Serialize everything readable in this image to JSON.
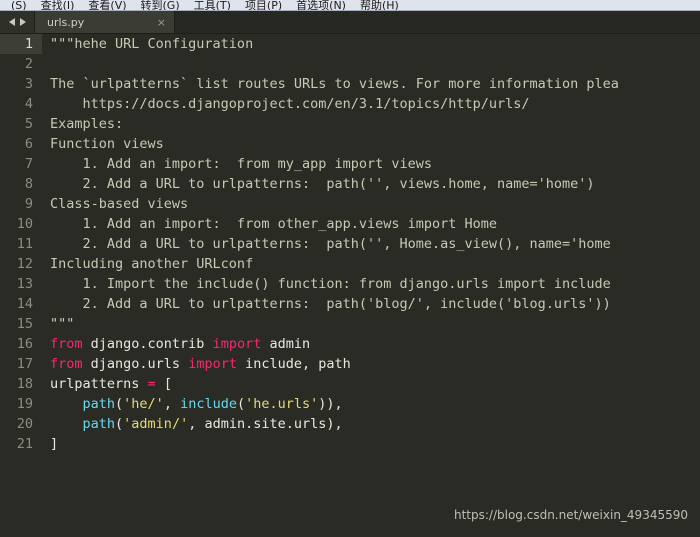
{
  "menu": {
    "items": [
      {
        "label": "(S)"
      },
      {
        "label": "查找(I)"
      },
      {
        "label": "查看(V)"
      },
      {
        "label": "转到(G)"
      },
      {
        "label": "工具(T)"
      },
      {
        "label": "项目(P)"
      },
      {
        "label": "首选项(N)"
      },
      {
        "label": "帮助(H)"
      }
    ]
  },
  "tabbar": {
    "nav_prev_icon": "arrow-left-icon",
    "nav_next_icon": "arrow-right-icon",
    "tabs": [
      {
        "label": "urls.py",
        "close_label": "×",
        "active": true
      }
    ]
  },
  "editor": {
    "active_line": 1,
    "colors": {
      "background": "#2b2b26",
      "gutter_text": "#8c8d7f",
      "active_gutter": "#3d3e35",
      "comment": "#c8c8b4",
      "keyword": "#f92672",
      "function": "#66d9ef",
      "string": "#e6db74",
      "plain": "#e8e8e0"
    },
    "lines": [
      {
        "n": "1",
        "tokens": [
          {
            "t": "doc",
            "s": "\"\"\"hehe URL Configuration"
          }
        ]
      },
      {
        "n": "2",
        "tokens": [
          {
            "t": "doc",
            "s": ""
          }
        ]
      },
      {
        "n": "3",
        "tokens": [
          {
            "t": "doc",
            "s": "The `urlpatterns` list routes URLs to views. For more information plea"
          }
        ]
      },
      {
        "n": "4",
        "tokens": [
          {
            "t": "doc",
            "s": "    https://docs.djangoproject.com/en/3.1/topics/http/urls/"
          }
        ]
      },
      {
        "n": "5",
        "tokens": [
          {
            "t": "doc",
            "s": "Examples:"
          }
        ]
      },
      {
        "n": "6",
        "tokens": [
          {
            "t": "doc",
            "s": "Function views"
          }
        ]
      },
      {
        "n": "7",
        "tokens": [
          {
            "t": "doc",
            "s": "    1. Add an import:  from my_app import views"
          }
        ]
      },
      {
        "n": "8",
        "tokens": [
          {
            "t": "doc",
            "s": "    2. Add a URL to urlpatterns:  path('', views.home, name='home')"
          }
        ]
      },
      {
        "n": "9",
        "tokens": [
          {
            "t": "doc",
            "s": "Class-based views"
          }
        ]
      },
      {
        "n": "10",
        "tokens": [
          {
            "t": "doc",
            "s": "    1. Add an import:  from other_app.views import Home"
          }
        ]
      },
      {
        "n": "11",
        "tokens": [
          {
            "t": "doc",
            "s": "    2. Add a URL to urlpatterns:  path('', Home.as_view(), name='home"
          }
        ]
      },
      {
        "n": "12",
        "tokens": [
          {
            "t": "doc",
            "s": "Including another URLconf"
          }
        ]
      },
      {
        "n": "13",
        "tokens": [
          {
            "t": "doc",
            "s": "    1. Import the include() function: from django.urls import include"
          }
        ]
      },
      {
        "n": "14",
        "tokens": [
          {
            "t": "doc",
            "s": "    2. Add a URL to urlpatterns:  path('blog/', include('blog.urls'))"
          }
        ]
      },
      {
        "n": "15",
        "tokens": [
          {
            "t": "doc",
            "s": "\"\"\""
          }
        ]
      },
      {
        "n": "16",
        "tokens": [
          {
            "t": "kw",
            "s": "from"
          },
          {
            "t": "plain",
            "s": " django.contrib "
          },
          {
            "t": "kw",
            "s": "import"
          },
          {
            "t": "plain",
            "s": " admin"
          }
        ]
      },
      {
        "n": "17",
        "tokens": [
          {
            "t": "kw",
            "s": "from"
          },
          {
            "t": "plain",
            "s": " django.urls "
          },
          {
            "t": "kw",
            "s": "import"
          },
          {
            "t": "plain",
            "s": " include, path"
          }
        ]
      },
      {
        "n": "18",
        "tokens": [
          {
            "t": "plain",
            "s": "urlpatterns "
          },
          {
            "t": "op",
            "s": "="
          },
          {
            "t": "plain",
            "s": " ["
          }
        ]
      },
      {
        "n": "19",
        "tokens": [
          {
            "t": "plain",
            "s": "    "
          },
          {
            "t": "fn",
            "s": "path"
          },
          {
            "t": "plain",
            "s": "("
          },
          {
            "t": "str",
            "s": "'he/'"
          },
          {
            "t": "plain",
            "s": ", "
          },
          {
            "t": "fn",
            "s": "include"
          },
          {
            "t": "plain",
            "s": "("
          },
          {
            "t": "str",
            "s": "'he.urls'"
          },
          {
            "t": "plain",
            "s": ")),"
          }
        ]
      },
      {
        "n": "20",
        "tokens": [
          {
            "t": "plain",
            "s": "    "
          },
          {
            "t": "fn",
            "s": "path"
          },
          {
            "t": "plain",
            "s": "("
          },
          {
            "t": "str",
            "s": "'admin/'"
          },
          {
            "t": "plain",
            "s": ", admin.site.urls),"
          }
        ]
      },
      {
        "n": "21",
        "tokens": [
          {
            "t": "plain",
            "s": "]"
          }
        ]
      }
    ]
  },
  "watermark": {
    "text": "https://blog.csdn.net/weixin_49345590"
  }
}
